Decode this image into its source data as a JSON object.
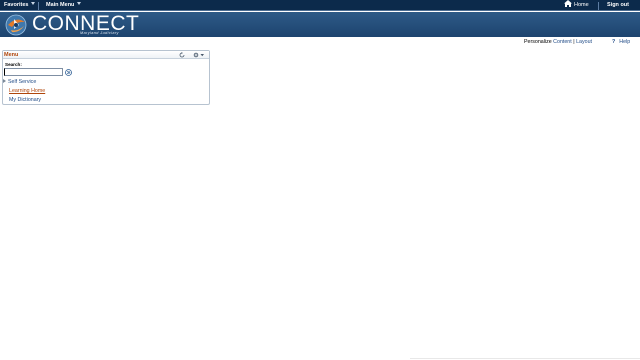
{
  "topnav": {
    "favorites": "Favorites",
    "main_menu": "Main Menu",
    "home": "Home",
    "sign_out": "Sign out"
  },
  "banner": {
    "brand": "CONNECT",
    "subtitle": "Maryland Judiciary"
  },
  "personalize": {
    "prefix": "Personalize",
    "content": "Content",
    "separator": "|",
    "layout": "Layout",
    "help": "Help"
  },
  "menu_pagelet": {
    "title": "Menu",
    "search_label": "Search:",
    "search_value": "",
    "items": [
      {
        "label": "Self Service"
      },
      {
        "label": "Learning Home"
      },
      {
        "label": "My Dictionary"
      }
    ]
  },
  "colors": {
    "nav_bg": "#0c2a4b",
    "banner_top": "#2e5a87",
    "banner_bottom": "#1d446f",
    "accent_orange": "#b0460b",
    "link_blue": "#1f4a86"
  }
}
